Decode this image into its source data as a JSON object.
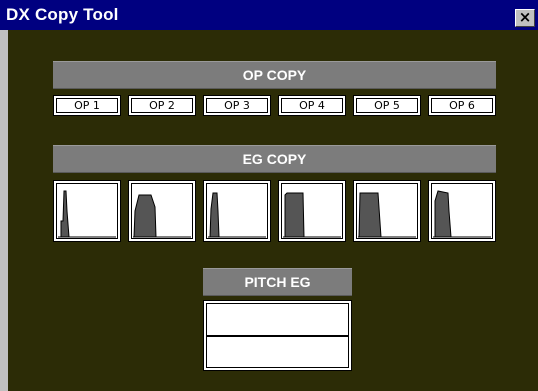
{
  "window": {
    "title": "DX Copy Tool"
  },
  "titlebar": {
    "close_icon": "close-x-icon",
    "close_glyph": "×"
  },
  "op_copy": {
    "header": "OP COPY",
    "buttons": [
      "OP 1",
      "OP 2",
      "OP 3",
      "OP 4",
      "OP 5",
      "OP 6"
    ]
  },
  "eg_copy": {
    "header": "EG COPY",
    "thumbnail_icon": "envelope-graph-icon"
  },
  "pitch_eg": {
    "header": "PITCH EG",
    "buttons": [
      "",
      ""
    ]
  },
  "colors": {
    "titlebar": "#000080",
    "client_background": "#2c2c06",
    "header_background": "#7c7c7c",
    "envelope_fill": "#555555"
  }
}
